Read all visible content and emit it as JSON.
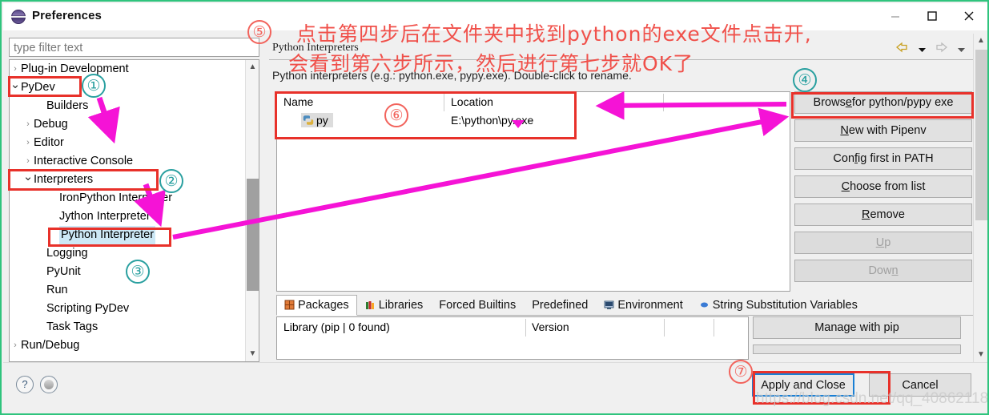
{
  "window": {
    "title": "Preferences",
    "icon": "eclipse-preferences-icon",
    "controls": {
      "minimize": "minimize-icon",
      "maximize": "maximize-icon",
      "close": "close-icon"
    }
  },
  "sidebar": {
    "filter": {
      "placeholder": "type filter text",
      "value": ""
    },
    "items": [
      {
        "label": "Plug-in Development",
        "arrow": "collapsed",
        "indent": 14,
        "selected": false
      },
      {
        "label": "PyDev",
        "arrow": "expanded",
        "indent": 14,
        "selected": false
      },
      {
        "label": "Builders",
        "arrow": "none",
        "indent": 46,
        "selected": false
      },
      {
        "label": "Debug",
        "arrow": "collapsed",
        "indent": 30,
        "selected": false
      },
      {
        "label": "Editor",
        "arrow": "collapsed",
        "indent": 30,
        "selected": false
      },
      {
        "label": "Interactive Console",
        "arrow": "collapsed",
        "indent": 30,
        "selected": false
      },
      {
        "label": "Interpreters",
        "arrow": "expanded",
        "indent": 30,
        "selected": false
      },
      {
        "label": "IronPython Interpreter",
        "arrow": "none",
        "indent": 62,
        "selected": false
      },
      {
        "label": "Jython Interpreter",
        "arrow": "none",
        "indent": 62,
        "selected": false
      },
      {
        "label": "Python Interpreter",
        "arrow": "none",
        "indent": 62,
        "selected": true
      },
      {
        "label": "Logging",
        "arrow": "none",
        "indent": 46,
        "selected": false
      },
      {
        "label": "PyUnit",
        "arrow": "none",
        "indent": 46,
        "selected": false
      },
      {
        "label": "Run",
        "arrow": "none",
        "indent": 46,
        "selected": false
      },
      {
        "label": "Scripting PyDev",
        "arrow": "none",
        "indent": 46,
        "selected": false
      },
      {
        "label": "Task Tags",
        "arrow": "none",
        "indent": 46,
        "selected": false
      },
      {
        "label": "Run/Debug",
        "arrow": "collapsed",
        "indent": 14,
        "selected": false
      }
    ]
  },
  "main": {
    "heading": "Python Interpreters",
    "description": "Python interpreters (e.g.: python.exe, pypy.exe).  Double-click to rename.",
    "interpreter_table": {
      "columns": [
        "Name",
        "Location"
      ],
      "rows": [
        {
          "name": "py",
          "icon": "python-file-icon",
          "location": "E:\\python\\py.exe"
        }
      ]
    },
    "buttons": [
      {
        "label": "Browse for python/pypy exe",
        "mnemonic": "e",
        "enabled": true
      },
      {
        "label": "New with Pipenv",
        "mnemonic": "N",
        "enabled": true
      },
      {
        "label": "Config first in PATH",
        "mnemonic": "f",
        "enabled": true
      },
      {
        "label": "Choose from list",
        "mnemonic": "C",
        "enabled": true
      },
      {
        "label": "Remove",
        "mnemonic": "R",
        "enabled": true
      },
      {
        "label": "Up",
        "mnemonic": "U",
        "enabled": false
      },
      {
        "label": "Down",
        "mnemonic": "n",
        "enabled": false
      }
    ],
    "tabs": [
      {
        "label": "Packages",
        "icon": "packages-icon",
        "active": true
      },
      {
        "label": "Libraries",
        "icon": "libraries-icon",
        "active": false
      },
      {
        "label": "Forced Builtins",
        "icon": "",
        "active": false
      },
      {
        "label": "Predefined",
        "icon": "",
        "active": false
      },
      {
        "label": "Environment",
        "icon": "environment-icon",
        "active": false
      },
      {
        "label": "String Substitution Variables",
        "icon": "string-var-icon",
        "active": false
      }
    ],
    "packages_table": {
      "columns": [
        "Library (pip | 0 found)",
        "Version"
      ],
      "rows": []
    },
    "pip_buttons": [
      {
        "label": "Manage with pip",
        "enabled": true
      }
    ]
  },
  "footer": {
    "help_icon": "question-mark-icon",
    "apply_icon": "apply-dot-icon",
    "apply_and_close": "Apply and Close",
    "cancel": "Cancel"
  },
  "annotations": {
    "line1": "点击第四步后在文件夹中找到python的exe文件点击开,",
    "line2": "会看到第六步所示，然后进行第七步就OK了",
    "steps": [
      "①",
      "②",
      "③",
      "④",
      "⑤",
      "⑥",
      "⑦"
    ],
    "watermark": "https://blog.csdn.net/qq_40862118",
    "colors": {
      "red_box": "#e8312a",
      "magenta_arrow": "#f513d6",
      "teal_circle": "#2aa0a0",
      "red_circle": "#f2635c",
      "cn_text": "#f0504a",
      "selection_blue": "#1a7fd4"
    }
  }
}
